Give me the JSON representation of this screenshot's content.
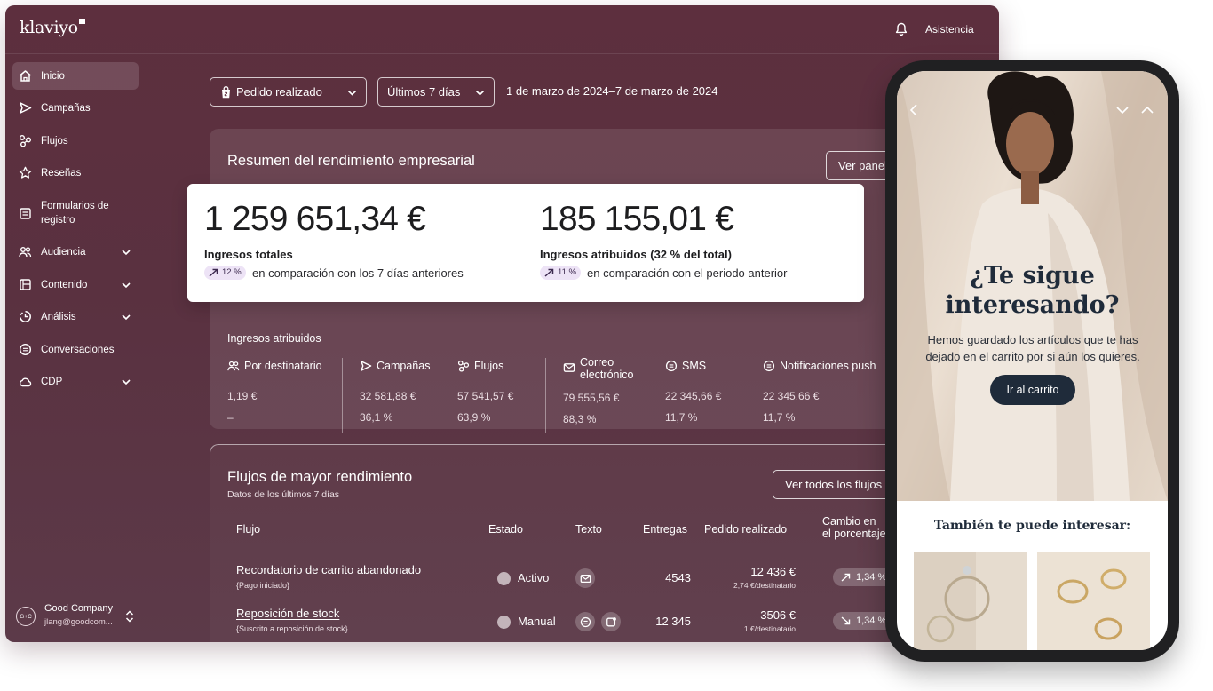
{
  "app": {
    "logo": "klaviyo",
    "help": "Asistencia"
  },
  "sidebar": {
    "items": [
      {
        "label": "Inicio",
        "icon": "home-icon",
        "active": true
      },
      {
        "label": "Campañas",
        "icon": "send-icon"
      },
      {
        "label": "Flujos",
        "icon": "flows-icon"
      },
      {
        "label": "Reseñas",
        "icon": "star-icon"
      },
      {
        "label": "Formularios de registro",
        "icon": "form-icon"
      },
      {
        "label": "Audiencia",
        "icon": "audience-icon",
        "expandable": true
      },
      {
        "label": "Contenido",
        "icon": "content-icon",
        "expandable": true
      },
      {
        "label": "Análisis",
        "icon": "analytics-icon",
        "expandable": true
      },
      {
        "label": "Conversaciones",
        "icon": "chat-icon"
      },
      {
        "label": "CDP",
        "icon": "cdp-icon",
        "expandable": true
      }
    ],
    "account": {
      "avatar": "G+C",
      "name": "Good Company",
      "email": "jlang@goodcom..."
    }
  },
  "filters": {
    "metric": "Pedido realizado",
    "period": "Últimos 7 días",
    "date_range": "1 de marzo de 2024–7 de marzo de 2024"
  },
  "summary": {
    "title": "Resumen del rendimiento empresarial",
    "view_button": "Ver panel",
    "total": {
      "value": "1 259 651,34 €",
      "label": "Ingresos totales",
      "change": "12 %",
      "comparison": "en comparación con los 7 días anteriores"
    },
    "attributed": {
      "value": "185 155,01 €",
      "label": "Ingresos atribuidos (32 % del total)",
      "change": "11 %",
      "comparison": "en comparación con el periodo anterior"
    },
    "breakdown_title": "Ingresos atribuidos",
    "columns": [
      {
        "label": "Por destinatario",
        "icon": "audience-icon",
        "value": "1,19 €",
        "sub": "–"
      },
      {
        "label": "Campañas",
        "icon": "send-icon",
        "value": "32 581,88 €",
        "sub": "36,1 %"
      },
      {
        "label": "Flujos",
        "icon": "flows-icon",
        "value": "57 541,57 €",
        "sub": "63,9 %"
      },
      {
        "label": "Correo electrónico",
        "icon": "mail-icon",
        "value": "79 555,56 €",
        "sub": "88,3 %"
      },
      {
        "label": "SMS",
        "icon": "sms-icon",
        "value": "22 345,66 €",
        "sub": "11,7 %"
      },
      {
        "label": "Notificaciones push",
        "icon": "sms-icon",
        "value": "22 345,66 €",
        "sub": "11,7 %"
      }
    ]
  },
  "flows": {
    "title": "Flujos de mayor rendimiento",
    "subtitle": "Datos de los últimos 7 días",
    "view_all": "Ver todos los flujos",
    "headers": {
      "flow": "Flujo",
      "status": "Estado",
      "text": "Texto",
      "deliveries": "Entregas",
      "ordered": "Pedido realizado",
      "change_1": "Cambio en",
      "change_2": "el porcentaje"
    },
    "rows": [
      {
        "name": "Recordatorio de carrito abandonado",
        "trigger": "{Pago iniciado}",
        "status": "Activo",
        "channels": [
          "mail-icon"
        ],
        "deliveries": "4543",
        "ordered": "12 436 €",
        "per_recipient": "2,74 €/destinatario",
        "change": "1,34 %",
        "trend": "up"
      },
      {
        "name": "Reposición de stock",
        "trigger": "{Suscrito a reposición de stock}",
        "status": "Manual",
        "channels": [
          "sms-icon",
          "push-icon"
        ],
        "deliveries": "12 345",
        "ordered": "3506 €",
        "per_recipient": "1 €/destinatario",
        "change": "1,34 %",
        "trend": "down"
      }
    ]
  },
  "phone": {
    "title_line1": "¿Te sigue",
    "title_line2": "interesando?",
    "body": "Hemos guardado los artículos que te has dejado en el carrito por si aún los quieres.",
    "cta": "Ir al carrito",
    "also": "También te puede interesar:"
  },
  "colors": {
    "brand_bg": "#5b3040",
    "cta": "#1f2b3a",
    "badge": "#ede3f6"
  }
}
